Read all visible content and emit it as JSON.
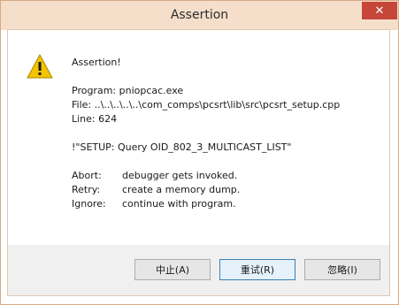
{
  "window": {
    "title": "Assertion",
    "close_glyph": "✕"
  },
  "message": {
    "heading": "Assertion!",
    "program": "Program: pniopcac.exe",
    "file": "File: ..\\..\\..\\..\\..\\com_comps\\pcsrt\\lib\\src\\pcsrt_setup.cpp",
    "line": "Line: 624",
    "expression": "!\"SETUP: Query OID_802_3_MULTICAST_LIST\"",
    "options": [
      {
        "key": "Abort:",
        "desc": "debugger gets invoked."
      },
      {
        "key": "Retry:",
        "desc": "create a memory dump."
      },
      {
        "key": "Ignore:",
        "desc": "continue with program."
      }
    ]
  },
  "buttons": {
    "abort": "中止(A)",
    "retry": "重试(R)",
    "ignore": "忽略(I)"
  },
  "icons": {
    "warning": "warning-icon",
    "close": "close-icon"
  },
  "colors": {
    "titlebar": "#f5dfcb",
    "close": "#c7463a",
    "warning": "#f5c400"
  }
}
